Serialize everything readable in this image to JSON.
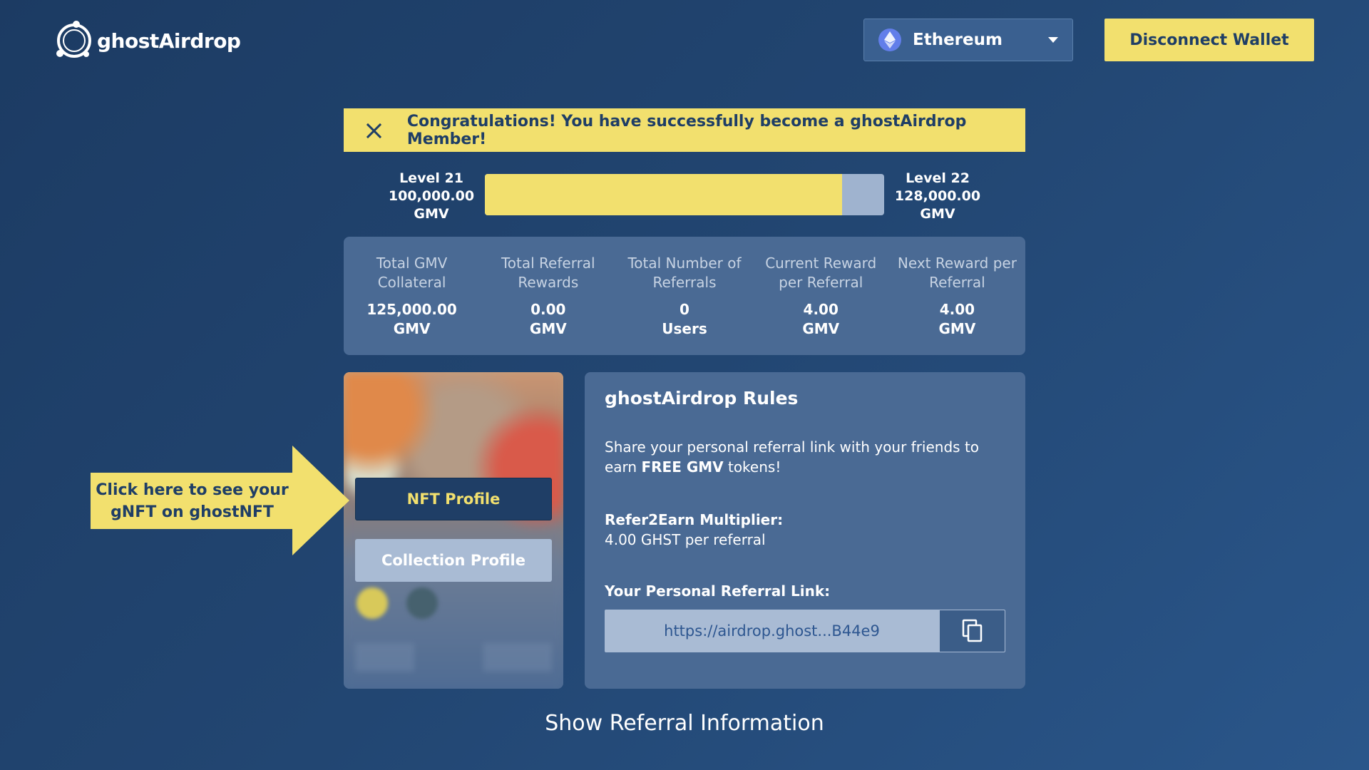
{
  "header": {
    "logo_text": "ghostAirdrop",
    "network": "Ethereum",
    "disconnect_label": "Disconnect Wallet"
  },
  "banner": {
    "message": "Congratulations! You have successfully become a ghostAirdrop Member!"
  },
  "progress": {
    "current_level": "Level 21",
    "current_amount": "100,000.00",
    "current_unit": "GMV",
    "next_level": "Level 22",
    "next_amount": "128,000.00",
    "next_unit": "GMV",
    "fill_percent": 89.5
  },
  "stats": [
    {
      "label": "Total GMV Collateral",
      "value": "125,000.00",
      "unit": "GMV"
    },
    {
      "label": "Total Referral Rewards",
      "value": "0.00",
      "unit": "GMV"
    },
    {
      "label": "Total Number of Referrals",
      "value": "0",
      "unit": "Users"
    },
    {
      "label": "Current Reward per Referral",
      "value": "4.00",
      "unit": "GMV"
    },
    {
      "label": "Next Reward per Referral",
      "value": "4.00",
      "unit": "GMV"
    }
  ],
  "nft_card": {
    "nft_profile_label": "NFT Profile",
    "collection_profile_label": "Collection Profile"
  },
  "callout": {
    "line1": "Click here to see your",
    "line2": "gNFT on ghostNFT"
  },
  "rules": {
    "title": "ghostAirdrop Rules",
    "desc_prefix": "Share your personal referral link with your friends to earn ",
    "desc_bold": "FREE GMV",
    "desc_suffix": " tokens!",
    "multiplier_label": "Refer2Earn Multiplier:",
    "multiplier_value": "4.00 GHST per referral",
    "link_label": "Your Personal Referral Link:",
    "link_value": "https://airdrop.ghost...B44e9"
  },
  "footer": {
    "show_referral": "Show Referral Information"
  },
  "colors": {
    "accent_yellow": "#f2e06e",
    "navy": "#1f3e66",
    "panel": "#4a6a94"
  },
  "icons": [
    "ghost-logo-icon",
    "ethereum-icon",
    "chevron-down-icon",
    "close-icon",
    "copy-icon"
  ]
}
